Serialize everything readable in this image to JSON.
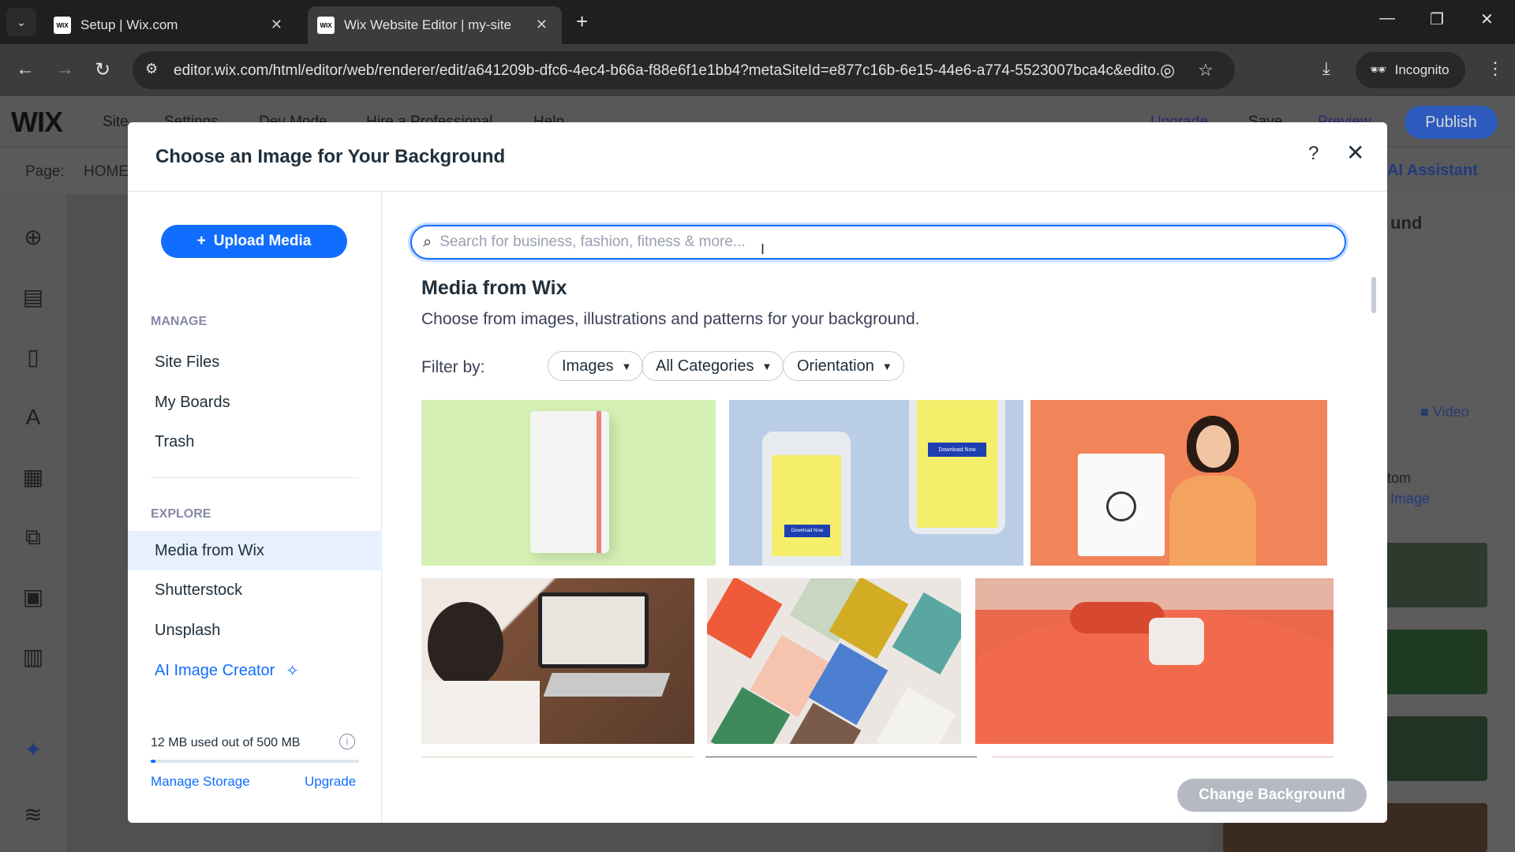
{
  "browser": {
    "tabs": [
      {
        "title": "Setup | Wix.com",
        "favicon": "WIX"
      },
      {
        "title": "Wix Website Editor | my-site",
        "favicon": "WIX"
      }
    ],
    "url": "editor.wix.com/html/editor/web/renderer/edit/a641209b-dfc6-4ec4-b66a-f88e6f1e1bb4?metaSiteId=e877c16b-6e15-44e6-a774-5523007bca4c&edito...",
    "profile_label": "Incognito"
  },
  "editor": {
    "logo": "WIX",
    "menu": [
      "Site",
      "Settings",
      "Dev Mode",
      "Hire a Professional",
      "Help"
    ],
    "right_links": [
      "Upgrade",
      "Save",
      "Preview"
    ],
    "publish_label": "Publish",
    "page_label": "Page:",
    "page_name": "HOME",
    "ai_assistant": "AI Assistant",
    "right_panel": {
      "heading_fragment": "und",
      "video_label": "Video",
      "custom_fragment": "tom",
      "ai_image_fragment": "I Image"
    }
  },
  "modal": {
    "title": "Choose an Image for Your Background",
    "help": "?",
    "close": "✕",
    "sidebar": {
      "upload_label": "Upload Media",
      "manage_label": "MANAGE",
      "manage_items": [
        "Site Files",
        "My Boards",
        "Trash"
      ],
      "explore_label": "EXPLORE",
      "explore_items": [
        "Media from Wix",
        "Shutterstock",
        "Unsplash"
      ],
      "ai_item": "AI Image Creator",
      "storage_text": "12 MB used out of 500 MB",
      "storage_used_fraction": 0.024,
      "manage_storage": "Manage Storage",
      "upgrade": "Upgrade"
    },
    "main": {
      "search_placeholder": "Search for business, fashion, fitness & more...",
      "title": "Media from Wix",
      "subtitle": "Choose from images, illustrations and patterns for your background.",
      "filter_label": "Filter by:",
      "filters": [
        "Images",
        "All Categories",
        "Orientation"
      ],
      "phone_button_text": "Download Now"
    },
    "change_background": "Change Background"
  },
  "colors": {
    "accent": "#116dff",
    "title": "#20303c"
  }
}
